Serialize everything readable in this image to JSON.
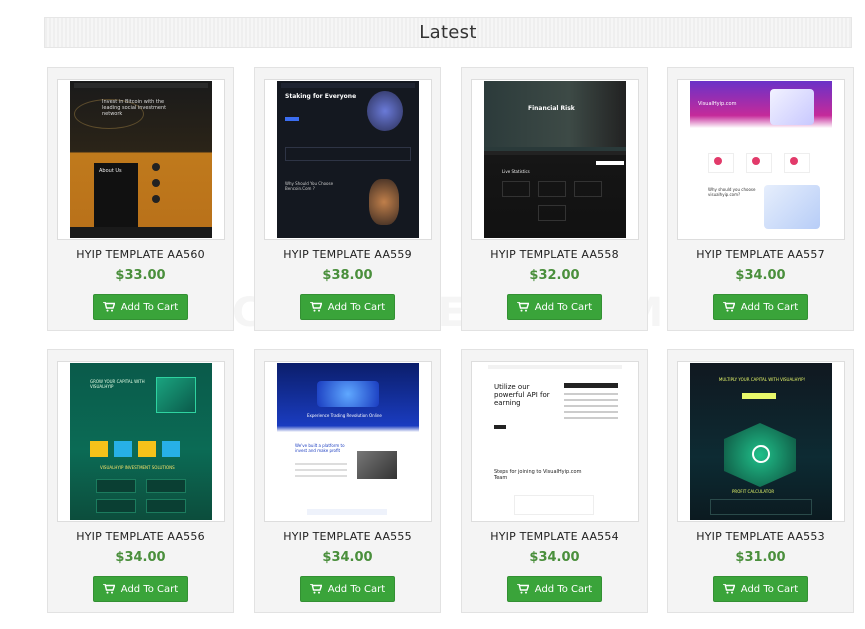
{
  "section": {
    "title": "Latest"
  },
  "cart_label": "Add To Cart",
  "accent_green": "#3aa43a",
  "price_color": "#4a8f3c",
  "products": [
    {
      "name": "HYIP TEMPLATE AA560",
      "price": "$33.00",
      "thumb_title": "Invest in Bitcoin with the leading social investment network",
      "thumb_sub": "About Us"
    },
    {
      "name": "HYIP TEMPLATE AA559",
      "price": "$38.00",
      "thumb_title": "Staking for Everyone",
      "thumb_sub": "Why Should You Choose Bencoin.Com ?"
    },
    {
      "name": "HYIP TEMPLATE AA558",
      "price": "$32.00",
      "thumb_title": "Financial Risk",
      "thumb_sub": "Live Statistics"
    },
    {
      "name": "HYIP TEMPLATE AA557",
      "price": "$34.00",
      "thumb_title": "VisualHyip.com",
      "thumb_sub": "Why should you choose visualhyip.com?"
    },
    {
      "name": "HYIP TEMPLATE AA556",
      "price": "$34.00",
      "thumb_title": "GROW YOUR CAPITAL WITH VISUALHYIP",
      "thumb_sub": "VISUALHYIP INVESTMENT SOLUTIONS"
    },
    {
      "name": "HYIP TEMPLATE AA555",
      "price": "$34.00",
      "thumb_title": "Experience Trading Revolution Online",
      "thumb_sub": "We've built a platform to invest and make profit"
    },
    {
      "name": "HYIP TEMPLATE AA554",
      "price": "$34.00",
      "thumb_title": "Utilize our powerful API for earning",
      "thumb_sub": "Steps for joining to VisualHyip.com Team"
    },
    {
      "name": "HYIP TEMPLATE AA553",
      "price": "$31.00",
      "thumb_title": "MULTIPLY YOUR CAPITAL WITH VISUALHYIP!",
      "thumb_sub": "PROFIT CALCULATOR"
    }
  ],
  "watermark": "CRYPTWERK.COM"
}
